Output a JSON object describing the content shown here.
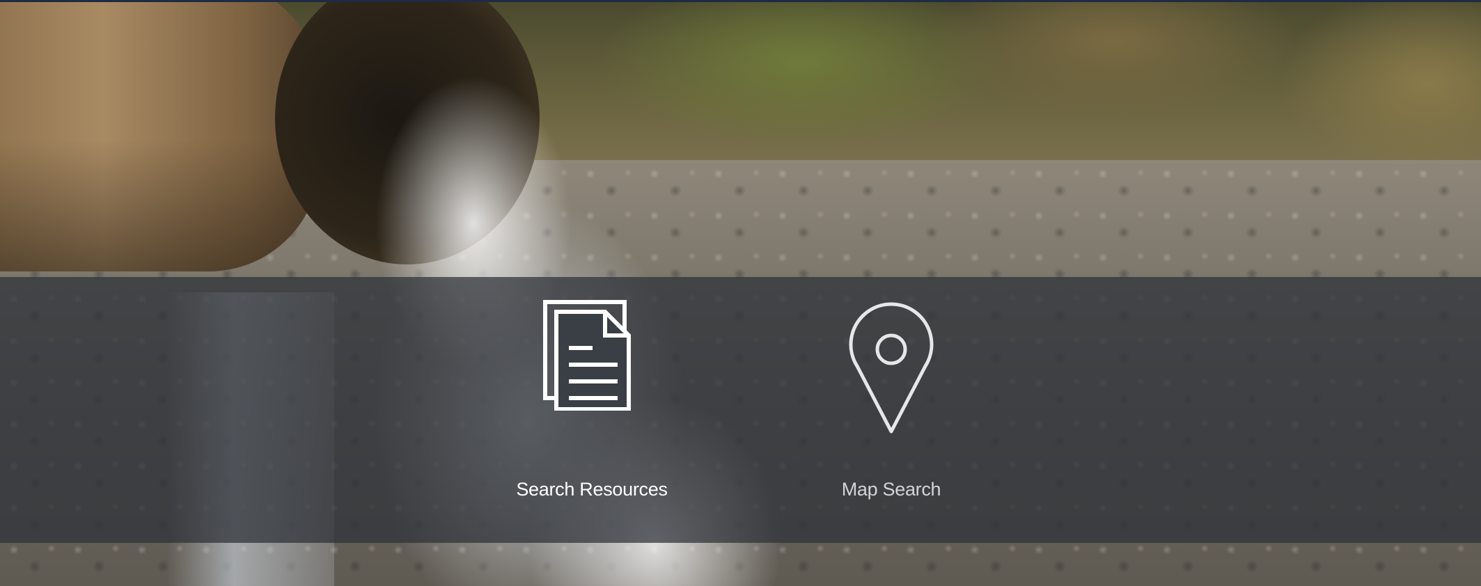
{
  "actions": [
    {
      "label": "Search Resources",
      "icon": "document-icon"
    },
    {
      "label": "Map Search",
      "icon": "map-pin-icon"
    }
  ],
  "colors": {
    "overlay": "#2c3038",
    "primary_label": "#ffffff",
    "secondary_label": "#d2d4d6"
  }
}
